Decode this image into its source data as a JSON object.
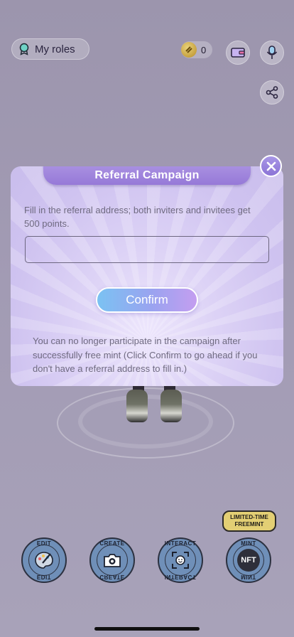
{
  "header": {
    "roles_label": "My roles",
    "coin_count": "0"
  },
  "modal": {
    "title": "Referral Campaign",
    "description": "Fill in the referral address; both inviters and invitees get 500 points.",
    "input_value": "",
    "input_placeholder": "",
    "confirm_label": "Confirm",
    "note": "You can no longer participate in the campaign after successfully free mint (Click Confirm to go ahead if you don't have a referral address to fill in.)"
  },
  "actions": [
    {
      "label": "EDIT",
      "icon": "palette-icon"
    },
    {
      "label": "CREATE",
      "icon": "camera-icon"
    },
    {
      "label": "INTERACT",
      "icon": "scan-face-icon"
    },
    {
      "label": "MINT",
      "icon": "nft-icon",
      "core_text": "NFT"
    }
  ],
  "promo": {
    "line1": "LIMITED-TIME",
    "line2": "FREEMINT"
  },
  "colors": {
    "modal_bg": "#d8cdf4",
    "title_tab": "#9c80dc",
    "confirm_gradient_start": "#7bc2f2",
    "confirm_gradient_end": "#c49ef0",
    "action_button": "#6f8fb8",
    "promo_badge": "#e3cf74"
  }
}
